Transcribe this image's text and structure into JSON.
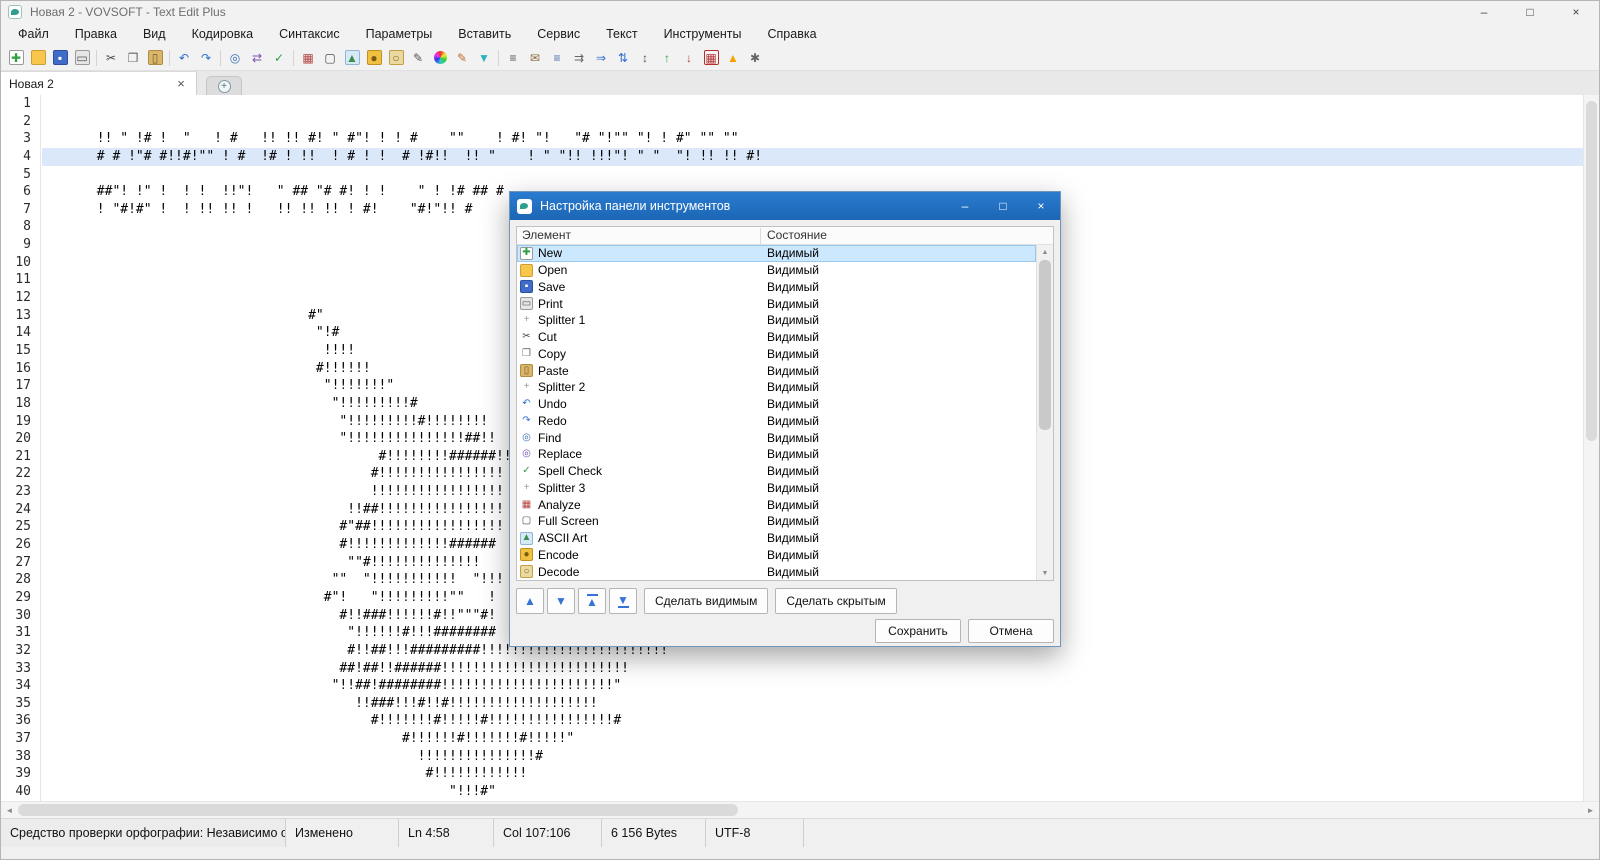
{
  "window": {
    "title": "Новая 2 - VOVSOFT - Text Edit Plus",
    "minimize": "–",
    "maximize": "□",
    "close": "×"
  },
  "menu": {
    "items": [
      "Файл",
      "Правка",
      "Вид",
      "Кодировка",
      "Синтаксис",
      "Параметры",
      "Вставить",
      "Сервис",
      "Текст",
      "Инструменты",
      "Справка"
    ]
  },
  "toolbar": {
    "icons": [
      {
        "name": "new",
        "g": "✚",
        "c": "#2f9e44",
        "bg": "#ffffff",
        "bd": "#9a9a9a"
      },
      {
        "name": "open",
        "g": "",
        "c": "#8a6d1e",
        "bg": "#f7c64b",
        "bd": "#caa035"
      },
      {
        "name": "save",
        "g": "▪",
        "c": "#ffffff",
        "bg": "#3f6cc9",
        "bd": "#2d4f9e"
      },
      {
        "name": "print",
        "g": "▭",
        "c": "#555555",
        "bg": "#e6e6e6",
        "bd": "#9a9a9a"
      },
      {
        "sep": true
      },
      {
        "name": "cut",
        "g": "✂",
        "c": "#444444"
      },
      {
        "name": "copy",
        "g": "❐",
        "c": "#666666"
      },
      {
        "name": "paste",
        "g": "▯",
        "c": "#7a5c28",
        "bg": "#d9b66a",
        "bd": "#b08c40"
      },
      {
        "sep": true
      },
      {
        "name": "undo",
        "g": "↶",
        "c": "#2e6fd0"
      },
      {
        "name": "redo",
        "g": "↷",
        "c": "#2e6fd0"
      },
      {
        "sep": true
      },
      {
        "name": "find",
        "g": "◎",
        "c": "#3b6fb5"
      },
      {
        "name": "replace",
        "g": "⇄",
        "c": "#7a4fb5"
      },
      {
        "name": "spell-check",
        "g": "✓",
        "c": "#2f9e44"
      },
      {
        "sep": true
      },
      {
        "name": "analyze",
        "g": "▦",
        "c": "#b0413e"
      },
      {
        "name": "full-screen",
        "g": "▢",
        "c": "#4a4a4a"
      },
      {
        "name": "ascii-art",
        "g": "▲",
        "c": "#3a8f4a",
        "bg": "#d7e9f7",
        "bd": "#8fb6d9"
      },
      {
        "name": "encode",
        "g": "●",
        "c": "#7a5a10",
        "bg": "#f0c040",
        "bd": "#c09020"
      },
      {
        "name": "decode",
        "g": "○",
        "c": "#7a5a10",
        "bg": "#ead9a0",
        "bd": "#c0a040"
      },
      {
        "name": "edit",
        "g": "✎",
        "c": "#555555"
      },
      {
        "name": "color-wheel",
        "wheel": true
      },
      {
        "name": "highlight",
        "g": "✎",
        "c": "#c06a2a"
      },
      {
        "name": "filter",
        "g": "▼",
        "c": "#2bb3c0"
      },
      {
        "sep": true
      },
      {
        "name": "statistics",
        "g": "≡",
        "c": "#555555"
      },
      {
        "name": "email",
        "g": "✉",
        "c": "#8a6d3b"
      },
      {
        "name": "numbered-list",
        "g": "≡",
        "c": "#4a6fa5"
      },
      {
        "name": "merge",
        "g": "⇉",
        "c": "#666666"
      },
      {
        "name": "goto",
        "g": "⇒",
        "c": "#2e6fd0"
      },
      {
        "name": "move-vertical",
        "g": "⇅",
        "c": "#2e6fd0"
      },
      {
        "name": "sort",
        "g": "↕",
        "c": "#555555"
      },
      {
        "name": "upload",
        "g": "↑",
        "c": "#2f9e44"
      },
      {
        "name": "download",
        "g": "↓",
        "c": "#b0413e"
      },
      {
        "name": "calendar",
        "g": "▦",
        "c": "#b03030",
        "bg": "#f5f5f5",
        "bd": "#b03030"
      },
      {
        "name": "warning",
        "g": "▲",
        "c": "#f0a500"
      },
      {
        "name": "tools",
        "g": "✱",
        "c": "#666666"
      }
    ]
  },
  "tabs": {
    "active_label": "Новая 2",
    "close_glyph": "×",
    "new_tab_glyph": "+"
  },
  "editor": {
    "current_line": 4,
    "lines": [
      "",
      "",
      "       !! \" !# !  \"   ! #   !! !! #! \" #\"! ! ! #    \"\"    ! #! \"!   \"# \"!\"\" \"! ! #\" \"\" \"\"",
      "       # # !\"# #!!#!\"\" ! #  !# ! !!  ! # ! !  # !#!!  !! \"    ! \" \"!! !!!\"! \" \"  \"! !! !! #!",
      "",
      "       ##\"! !\" !  ! !  !!\"!   \" ## \"# #! ! !    \" ! !# ## #",
      "       ! \"#!#\" !  ! !! !! !   !! !! !! ! #!    \"#!\"!! #",
      "",
      "",
      "",
      "",
      "",
      "                                  #\"",
      "                                   \"!#",
      "                                    !!!!",
      "                                   #!!!!!!",
      "                                    \"!!!!!!!\"",
      "                                     \"!!!!!!!!!#",
      "                                      \"!!!!!!!!!#!!!!!!!!",
      "                                      \"!!!!!!!!!!!!!!!##!!",
      "                                           #!!!!!!!!######!!!",
      "                                          #!!!!!!!!!!!!!!!!",
      "                                          !!!!!!!!!!!!!!!!!",
      "                                       !!##!!!!!!!!!!!!!!!!",
      "                                      #\"##!!!!!!!!!!!!!!!!!",
      "                                      #!!!!!!!!!!!!!######",
      "                                       \"\"#!!!!!!!!!!!!!!",
      "                                     \"\"  \"!!!!!!!!!!!  \"!!!",
      "                                    #\"!   \"!!!!!!!!!\"\"   !",
      "                                      #!!###!!!!!!#!!\"\"\"#!",
      "                                       \"!!!!!!#!!!########",
      "                                       #!!##!!!#########!!!!!!!!!!!!!!!!!!!!!!!!",
      "                                      ##!##!!######!!!!!!!!!!!!!!!!!!!!!!!!",
      "                                     \"!!##!########!!!!!!!!!!!!!!!!!!!!!!\"",
      "                                        !!###!!!#!!#!!!!!!!!!!!!!!!!!!!",
      "                                          #!!!!!!!#!!!!!#!!!!!!!!!!!!!!!!#",
      "                                              #!!!!!!#!!!!!!!#!!!!!\"",
      "                                                !!!!!!!!!!!!!!!#",
      "                                                 #!!!!!!!!!!!!",
      "                                                    \"!!!#\""
    ]
  },
  "dialog": {
    "title": "Настройка панели инструментов",
    "minimize": "–",
    "maximize": "□",
    "close": "×",
    "columns": [
      "Элемент",
      "Состояние"
    ],
    "items": [
      {
        "label": "New",
        "state": "Видимый",
        "selected": true,
        "icon_name": "new",
        "icon": {
          "g": "✚",
          "c": "#2f9e44",
          "bg": "#ffffff",
          "bd": "#9a9a9a"
        }
      },
      {
        "label": "Open",
        "state": "Видимый",
        "icon_name": "open",
        "icon": {
          "g": "",
          "c": "#8a6d1e",
          "bg": "#f7c64b",
          "bd": "#caa035"
        }
      },
      {
        "label": "Save",
        "state": "Видимый",
        "icon_name": "save",
        "icon": {
          "g": "▪",
          "c": "#ffffff",
          "bg": "#3f6cc9",
          "bd": "#2d4f9e"
        }
      },
      {
        "label": "Print",
        "state": "Видимый",
        "icon_name": "print",
        "icon": {
          "g": "▭",
          "c": "#555555",
          "bg": "#e6e6e6",
          "bd": "#9a9a9a"
        }
      },
      {
        "label": "Splitter 1",
        "state": "Видимый",
        "icon_name": "splitter",
        "icon": {
          "g": "+",
          "c": "#9a9a9a"
        }
      },
      {
        "label": "Cut",
        "state": "Видимый",
        "icon_name": "cut",
        "icon": {
          "g": "✂",
          "c": "#444444"
        }
      },
      {
        "label": "Copy",
        "state": "Видимый",
        "icon_name": "copy",
        "icon": {
          "g": "❐",
          "c": "#666666"
        }
      },
      {
        "label": "Paste",
        "state": "Видимый",
        "icon_name": "paste",
        "icon": {
          "g": "▯",
          "c": "#7a5c28",
          "bg": "#d9b66a",
          "bd": "#b08c40"
        }
      },
      {
        "label": "Splitter 2",
        "state": "Видимый",
        "icon_name": "splitter",
        "icon": {
          "g": "+",
          "c": "#9a9a9a"
        }
      },
      {
        "label": "Undo",
        "state": "Видимый",
        "icon_name": "undo",
        "icon": {
          "g": "↶",
          "c": "#2e6fd0"
        }
      },
      {
        "label": "Redo",
        "state": "Видимый",
        "icon_name": "redo",
        "icon": {
          "g": "↷",
          "c": "#2e6fd0"
        }
      },
      {
        "label": "Find",
        "state": "Видимый",
        "icon_name": "find",
        "icon": {
          "g": "◎",
          "c": "#3b6fb5"
        }
      },
      {
        "label": "Replace",
        "state": "Видимый",
        "icon_name": "replace",
        "icon": {
          "g": "◎",
          "c": "#7a4fb5"
        }
      },
      {
        "label": "Spell Check",
        "state": "Видимый",
        "icon_name": "spell-check",
        "icon": {
          "g": "✓",
          "c": "#2f9e44"
        }
      },
      {
        "label": "Splitter 3",
        "state": "Видимый",
        "icon_name": "splitter",
        "icon": {
          "g": "+",
          "c": "#9a9a9a"
        }
      },
      {
        "label": "Analyze",
        "state": "Видимый",
        "icon_name": "analyze",
        "icon": {
          "g": "▦",
          "c": "#b0413e"
        }
      },
      {
        "label": "Full Screen",
        "state": "Видимый",
        "icon_name": "full-screen",
        "icon": {
          "g": "▢",
          "c": "#4a4a4a"
        }
      },
      {
        "label": "ASCII Art",
        "state": "Видимый",
        "icon_name": "ascii-art",
        "icon": {
          "g": "▲",
          "c": "#3a8f4a",
          "bg": "#d7e9f7",
          "bd": "#8fb6d9"
        }
      },
      {
        "label": "Encode",
        "state": "Видимый",
        "icon_name": "encode",
        "icon": {
          "g": "●",
          "c": "#7a5a10",
          "bg": "#f0c040",
          "bd": "#c09020"
        }
      },
      {
        "label": "Decode",
        "state": "Видимый",
        "icon_name": "decode",
        "icon": {
          "g": "○",
          "c": "#7a5a10",
          "bg": "#ead9a0",
          "bd": "#c0a040"
        }
      }
    ],
    "move_buttons": [
      {
        "name": "move-up",
        "glyph": "▲"
      },
      {
        "name": "move-down",
        "glyph": "▼"
      },
      {
        "name": "move-top",
        "glyph": "▲",
        "bar": "top"
      },
      {
        "name": "move-bottom",
        "glyph": "▼",
        "bar": "bottom"
      }
    ],
    "buttons": {
      "make_visible": "Сделать видимым",
      "make_hidden": "Сделать скрытым",
      "save": "Сохранить",
      "cancel": "Отмена"
    }
  },
  "scroll": {
    "left_arrow": "◄",
    "right_arrow": "►",
    "up_arrow": "▲",
    "down_arrow": "▼"
  },
  "statusbar": {
    "segments": [
      "Средство проверки орфографии: Независимо от",
      "Изменено",
      "Ln 4:58",
      "Col 107:106",
      "6 156 Bytes",
      "UTF-8"
    ]
  }
}
